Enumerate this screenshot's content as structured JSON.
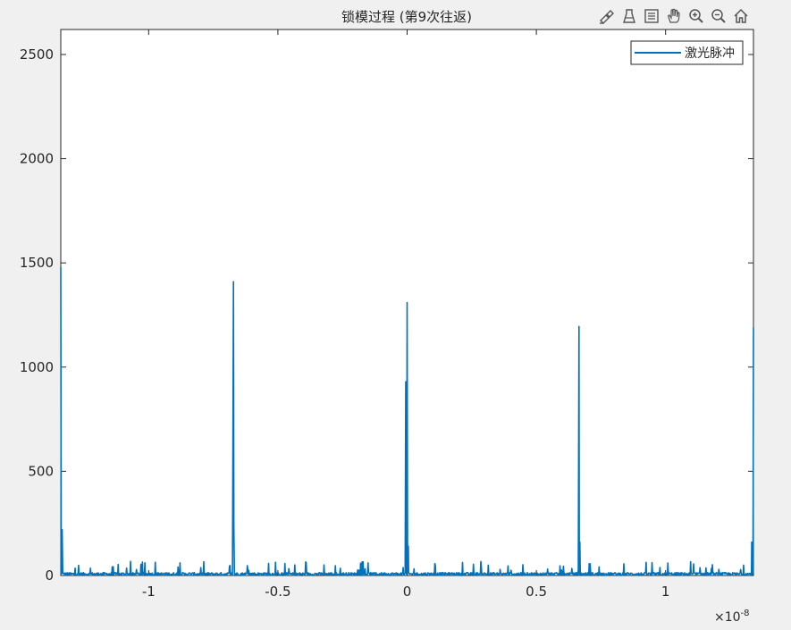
{
  "toolbar": {
    "icons": [
      "brush-icon",
      "data-tips-icon",
      "insert-legend-icon",
      "pan-hand-icon",
      "zoom-in-icon",
      "zoom-out-icon",
      "home-icon"
    ]
  },
  "chart_data": {
    "type": "line",
    "title": "锁模过程 (第9次往返)",
    "xlabel": "",
    "ylabel": "",
    "x_exponent_label": "×10",
    "x_exponent_power": "-8",
    "xlim": [
      -1.34e-08,
      1.34e-08
    ],
    "ylim": [
      0,
      2620
    ],
    "xticks": [
      -1e-08,
      -5e-09,
      0,
      5e-09,
      1e-08
    ],
    "xtick_labels": [
      "-1",
      "-0.5",
      "0",
      "0.5",
      "1"
    ],
    "yticks": [
      0,
      500,
      1000,
      1500,
      2000,
      2500
    ],
    "ytick_labels": [
      "0",
      "500",
      "1000",
      "1500",
      "2000",
      "2500"
    ],
    "legend": {
      "position": "top-right",
      "entries": [
        "激光脉冲"
      ]
    },
    "grid": false,
    "color": "#0072BD",
    "series": [
      {
        "name": "激光脉冲",
        "peaks": [
          {
            "x": -1.34e-08,
            "y": 1480
          },
          {
            "x": -1.3347e-08,
            "y": 220
          },
          {
            "x": -6.735e-09,
            "y": 800
          },
          {
            "x": -6.719e-09,
            "y": 1410
          },
          {
            "x": -6.703e-09,
            "y": 230
          },
          {
            "x": -5.3e-11,
            "y": 930
          },
          {
            "x": 0.0,
            "y": 1310
          },
          {
            "x": 4.7e-11,
            "y": 140
          },
          {
            "x": 6.633e-09,
            "y": 1065
          },
          {
            "x": 6.65e-09,
            "y": 1195
          },
          {
            "x": 6.683e-09,
            "y": 160
          },
          {
            "x": 1.3333e-08,
            "y": 160
          },
          {
            "x": 1.34e-08,
            "y": 1190
          }
        ],
        "noise_level": 40
      }
    ]
  }
}
